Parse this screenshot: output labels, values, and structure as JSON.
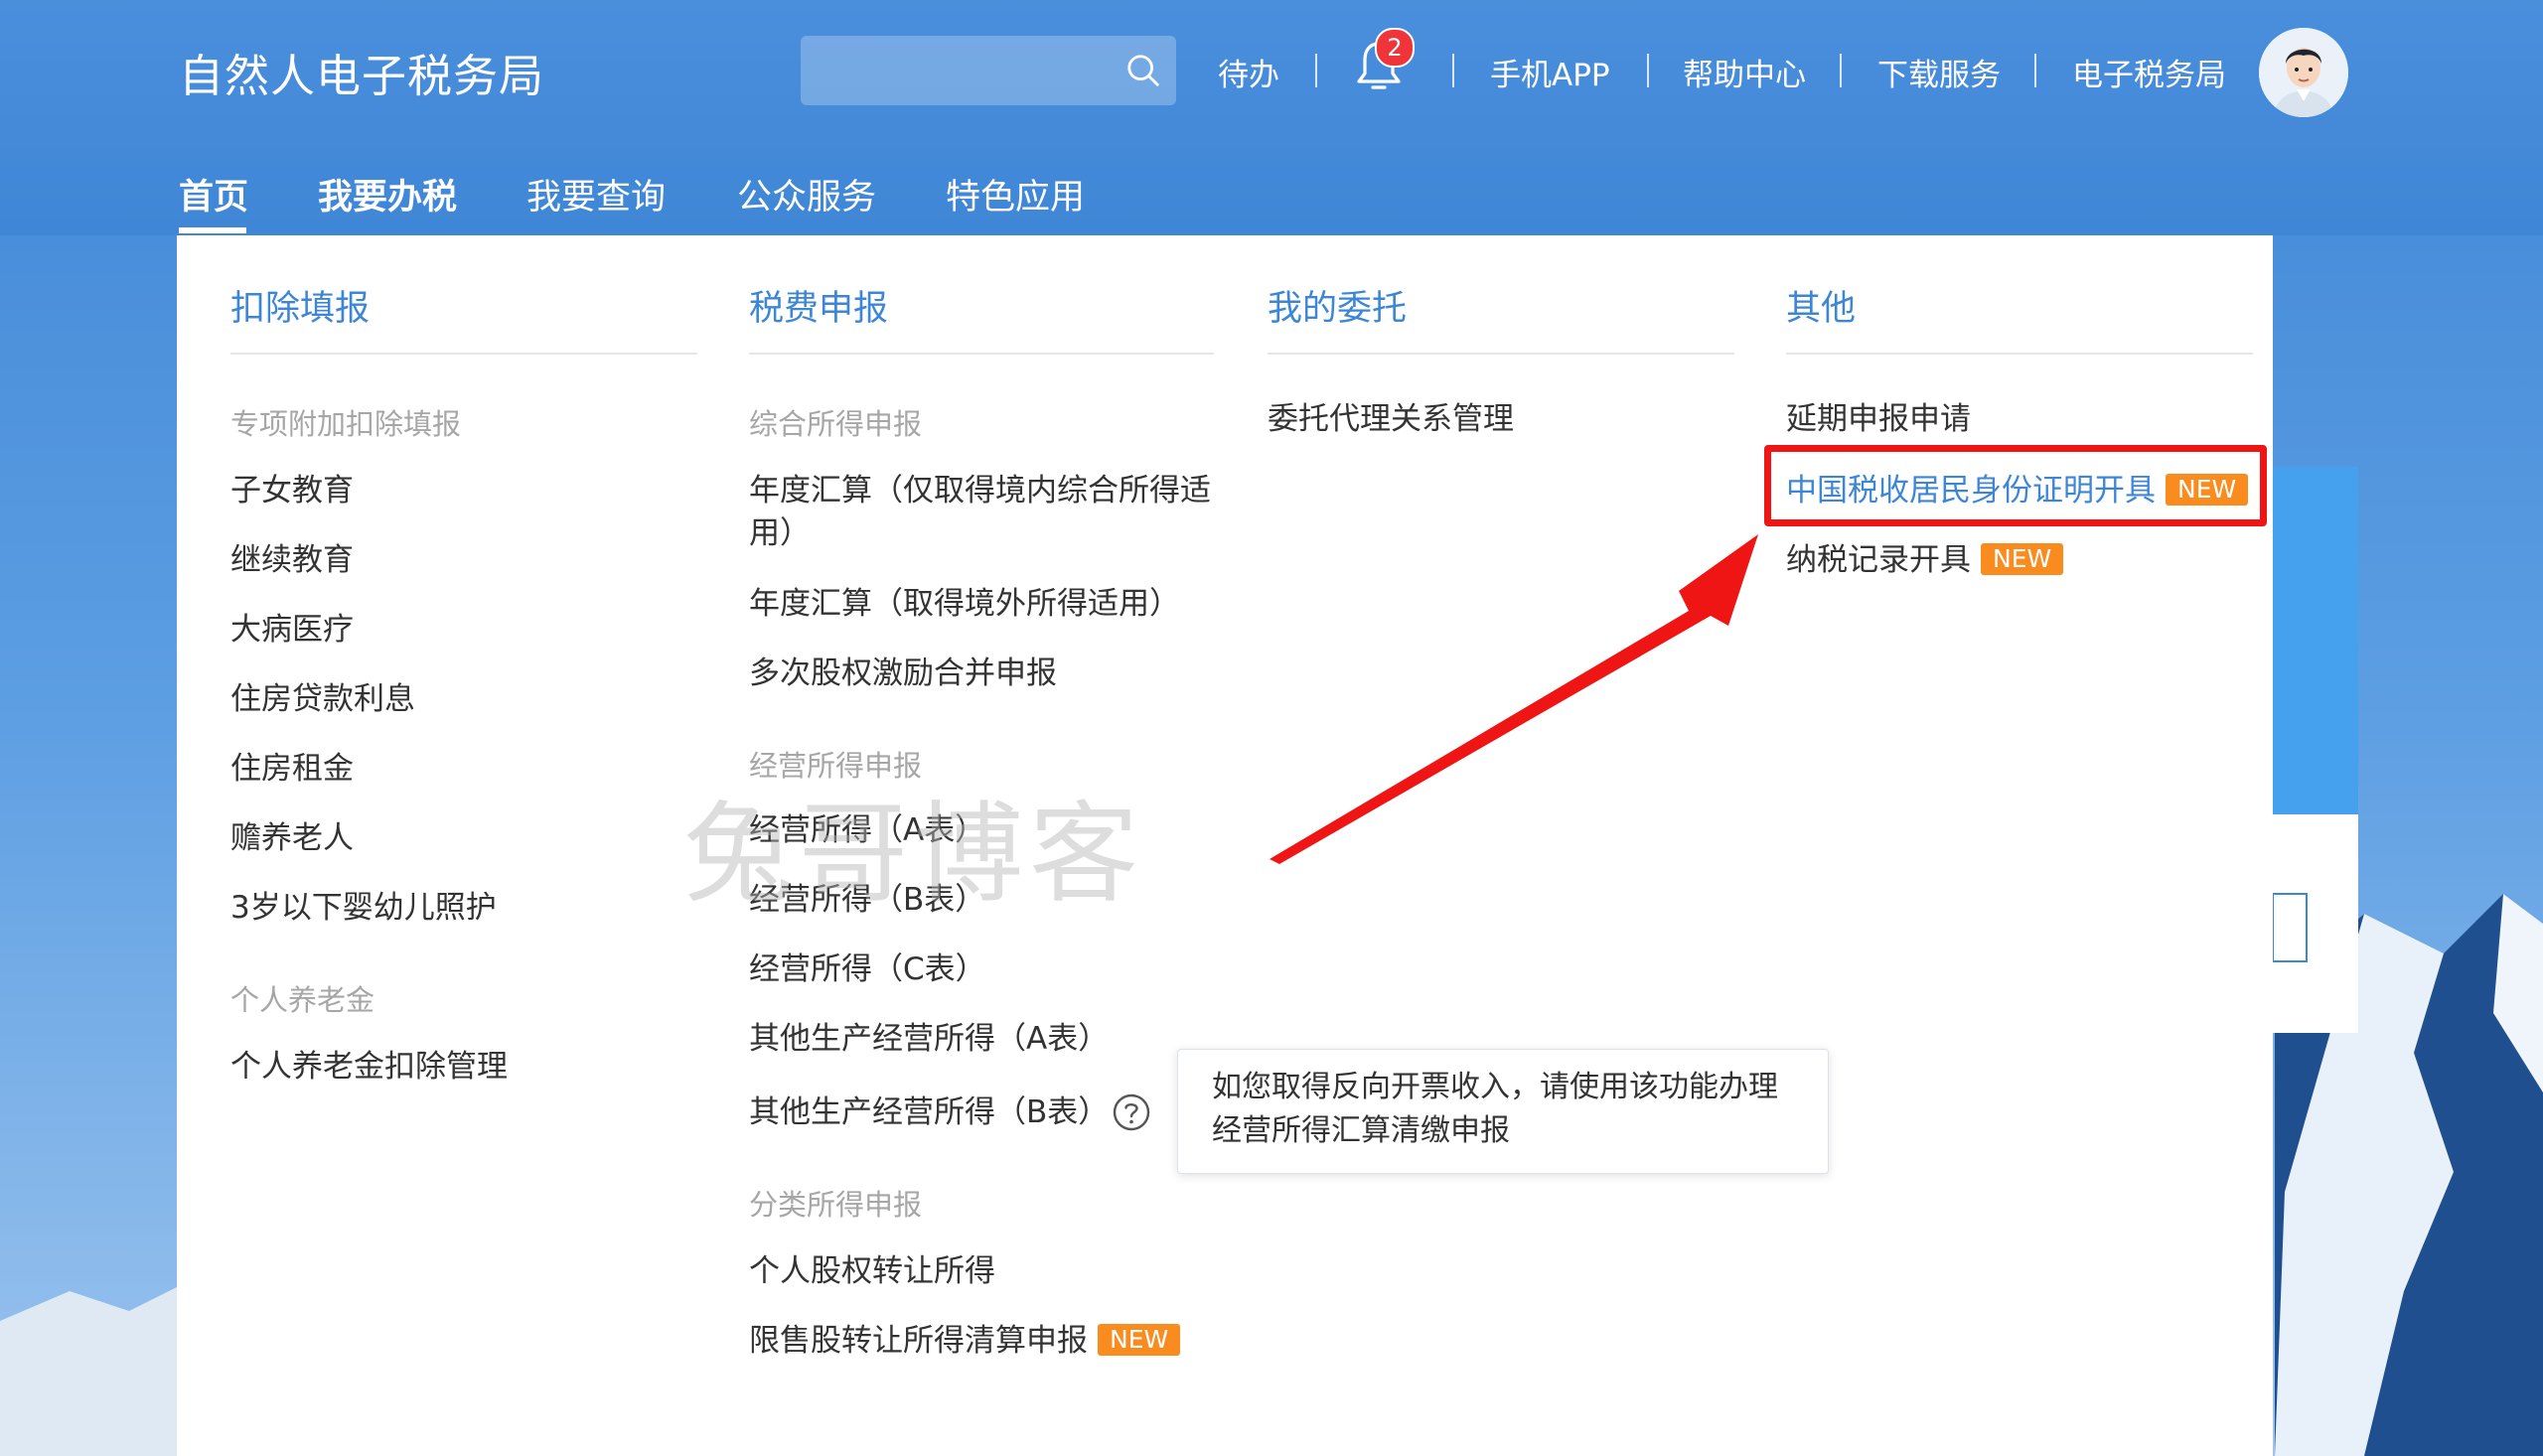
{
  "header": {
    "site_title": "自然人电子税务局",
    "search": {
      "placeholder": ""
    },
    "top_links": [
      "待办",
      "手机APP",
      "帮助中心",
      "下载服务",
      "电子税务局"
    ],
    "notification_count": "2"
  },
  "main_nav": [
    "首页",
    "我要办税",
    "我要查询",
    "公众服务",
    "特色应用"
  ],
  "dropdown": {
    "columns": [
      {
        "title": "扣除填报",
        "section1": "专项附加扣除填报",
        "items1": [
          "子女教育",
          "继续教育",
          "大病医疗",
          "住房贷款利息",
          "住房租金",
          "赡养老人",
          "3岁以下婴幼儿照护"
        ],
        "section2": "个人养老金",
        "items2": [
          "个人养老金扣除管理"
        ]
      },
      {
        "title": "税费申报",
        "section1": "综合所得申报",
        "items1": [
          "年度汇算（仅取得境内综合所得适",
          "用）",
          "年度汇算（取得境外所得适用）",
          "多次股权激励合并申报"
        ],
        "section2": "经营所得申报",
        "items2": [
          "经营所得（A表）",
          "经营所得（B表）",
          "经营所得（C表）",
          "其他生产经营所得（A表）",
          "其他生产经营所得（B表）"
        ],
        "section3": "分类所得申报",
        "items3": [
          "个人股权转让所得",
          "限售股转让所得清算申报"
        ]
      },
      {
        "title": "我的委托",
        "items1": [
          "委托代理关系管理"
        ]
      },
      {
        "title": "其他",
        "items1": [
          "延期申报申请",
          "中国税收居民身份证明开具",
          "纳税记录开具"
        ]
      }
    ],
    "new_tag": "NEW",
    "tooltip": [
      "如您取得反向开票收入，请使用该功能办理",
      "经营所得汇算清缴申报"
    ]
  },
  "watermark": "兔哥博客",
  "colors": {
    "primary": "#3d86d6",
    "new_tag": "#fa8b1e",
    "highlight": "#f01515"
  }
}
